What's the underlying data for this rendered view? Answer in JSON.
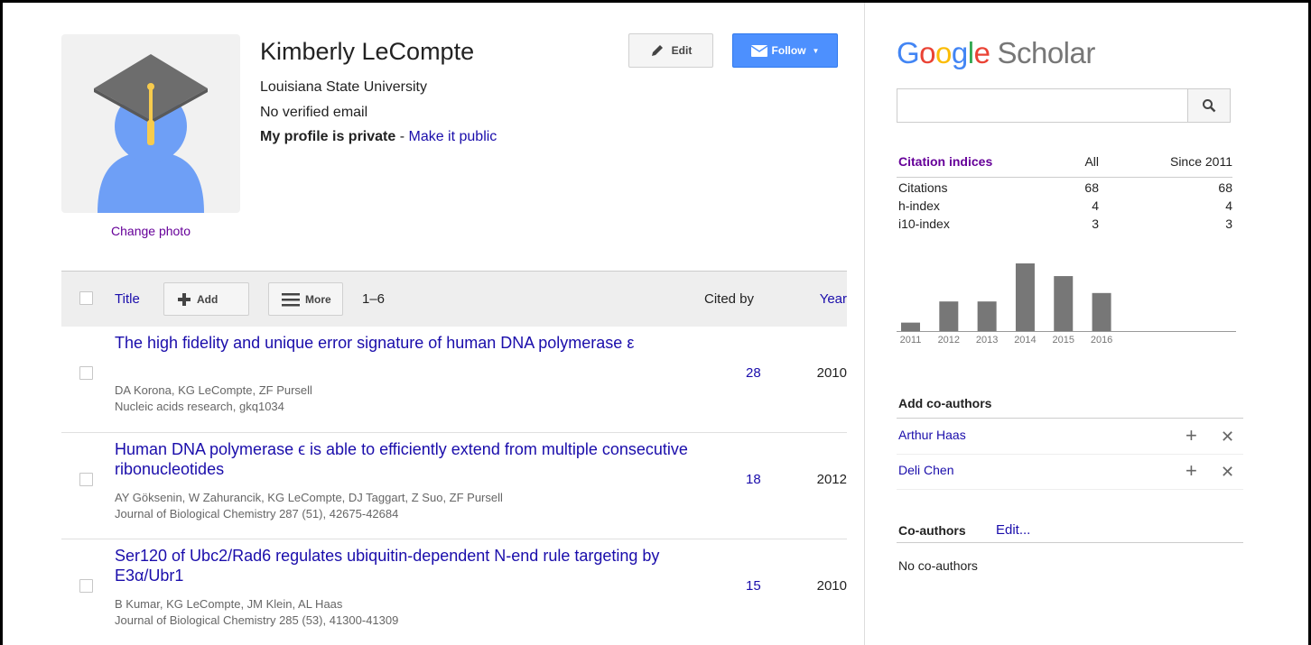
{
  "profile": {
    "name": "Kimberly LeCompte",
    "affiliation": "Louisiana State University",
    "email_status": "No verified email",
    "privacy_status": "My profile is private",
    "privacy_sep": " - ",
    "make_public_link": "Make it public",
    "change_photo_link": "Change photo",
    "edit_label": "Edit",
    "follow_label": "Follow"
  },
  "articles_header": {
    "title_label": "Title",
    "add_label": "Add",
    "more_label": "More",
    "range": "1–6",
    "cited_by_label": "Cited by",
    "year_label": "Year"
  },
  "articles": [
    {
      "title": "The high fidelity and unique error signature of human DNA polymerase ε",
      "authors": "DA Korona, KG LeCompte, ZF Pursell",
      "venue": "Nucleic acids research, gkq1034",
      "cited_by": "28",
      "year": "2010"
    },
    {
      "title": "Human DNA polymerase ϵ is able to efficiently extend from multiple consecutive ribonucleotides",
      "authors": "AY Göksenin, W Zahurancik, KG LeCompte, DJ Taggart, Z Suo, ZF Pursell",
      "venue": "Journal of Biological Chemistry 287 (51), 42675-42684",
      "cited_by": "18",
      "year": "2012"
    },
    {
      "title": "Ser120 of Ubc2/Rad6 regulates ubiquitin-dependent N-end rule targeting by E3α/Ubr1",
      "authors": "B Kumar, KG LeCompte, JM Klein, AL Haas",
      "venue": "Journal of Biological Chemistry 285 (53), 41300-41309",
      "cited_by": "15",
      "year": "2010"
    }
  ],
  "sidebar": {
    "logo_google": "Google",
    "logo_scholar": "Scholar",
    "search_placeholder": "",
    "citation_indices": {
      "header": [
        "Citation indices",
        "All",
        "Since 2011"
      ],
      "rows": [
        [
          "Citations",
          "68",
          "68"
        ],
        [
          "h-index",
          "4",
          "4"
        ],
        [
          "i10-index",
          "3",
          "3"
        ]
      ]
    },
    "add_coauthors_title": "Add co-authors",
    "suggested_coauthors": [
      "Arthur Haas",
      "Deli Chen"
    ],
    "coauthors_title": "Co-authors",
    "coauthors_edit": "Edit...",
    "no_coauthors": "No co-authors"
  },
  "chart_data": {
    "type": "bar",
    "categories": [
      "2011",
      "2012",
      "2013",
      "2014",
      "2015",
      "2016"
    ],
    "values": [
      2,
      7,
      7,
      16,
      13,
      9
    ],
    "title": "",
    "xlabel": "",
    "ylabel": "",
    "bar_color": "#777777",
    "grid": false
  },
  "colors": {
    "link": "#1a0dab",
    "visited": "#660099",
    "follow_button": "#4d90fe",
    "google_blue": "#4285f4",
    "google_red": "#ea4335",
    "google_yellow": "#fbbc05",
    "google_green": "#34a853"
  }
}
